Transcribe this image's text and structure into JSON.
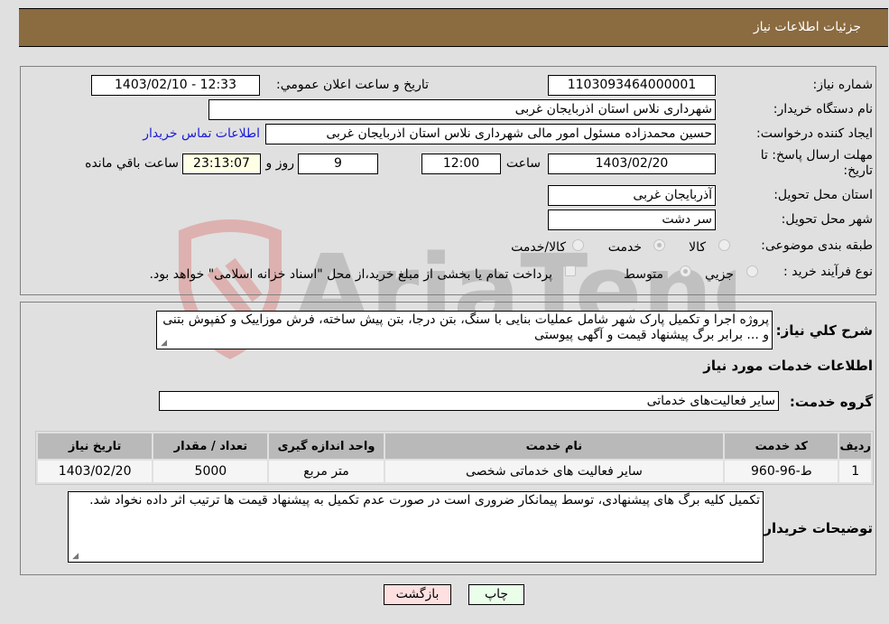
{
  "header": {
    "title": "جزئیات اطلاعات نیاز"
  },
  "form": {
    "need_number": {
      "label": "شماره نیاز:",
      "value": "1103093464000001"
    },
    "announce_datetime": {
      "label": "تاریخ و ساعت اعلان عمومي:",
      "value": "1403/02/10 - 12:33"
    },
    "buyer_org": {
      "label": "نام دستگاه خریدار:",
      "value": "شهرداری نلاس استان اذربایجان غربی"
    },
    "requester": {
      "label": "ایجاد کننده درخواست:",
      "value": "حسین محمدزاده مسئول امور مالی شهرداری نلاس استان اذربایجان غربی"
    },
    "buyer_contact_link": "اطلاعات تماس خریدار",
    "deadline": {
      "label": "مهلت ارسال پاسخ: تا تاریخ:",
      "date": "1403/02/20",
      "time_label": "ساعت",
      "time": "12:00",
      "days": "9",
      "days_label": "روز و",
      "remaining": "23:13:07",
      "remaining_label": "ساعت باقي مانده"
    },
    "delivery_province": {
      "label": "استان محل تحویل:",
      "value": "آذربایجان غربی"
    },
    "delivery_city": {
      "label": "شهر محل تحویل:",
      "value": "سر دشت"
    },
    "category": {
      "label": "طبقه بندی موضوعی:",
      "options": [
        "کالا",
        "خدمت",
        "کالا/خدمت"
      ],
      "selected": "خدمت"
    },
    "purchase_type": {
      "label": "نوع فرآیند خرید :",
      "options": [
        "جزيي",
        "متوسط"
      ],
      "selected": "متوسط",
      "note": "پرداخت تمام یا بخشی از مبلغ خرید،از محل \"اسناد خزانه اسلامی\" خواهد بود."
    }
  },
  "description": {
    "label": "شرح کلي نیاز:",
    "value": "پروژه اجرا و تکمیل پارک شهر شامل عملیات بنایی با سنگ، بتن درجا، بتن پیش ساخته، فرش موزاییک و کفپوش بتنی و ... برابر برگ پیشنهاد قیمت و آگهی پیوستی"
  },
  "services": {
    "section_title": "اطلاعات خدمات مورد نیاز",
    "group_label": "گروه خدمت:",
    "group_value": "سایر فعالیت‌های خدماتی",
    "table": {
      "headers": [
        "ردیف",
        "کد خدمت",
        "نام خدمت",
        "واحد اندازه گیری",
        "تعداد / مقدار",
        "تاریخ نیاز"
      ],
      "rows": [
        [
          "1",
          "ط-96-960",
          "سایر فعالیت های خدماتی شخصی",
          "متر مربع",
          "5000",
          "1403/02/20"
        ]
      ]
    }
  },
  "buyer_notes": {
    "label": "توضیحات خریدار:",
    "value": "تکمیل کلیه برگ های پیشنهادی، توسط پیمانکار ضروری است در صورت عدم تکمیل به پیشنهاد قیمت ها ترتیب اثر داده نخواد شد."
  },
  "buttons": {
    "print": "چاپ",
    "back": "بازگشت"
  },
  "colors": {
    "header_bg": "#8b6b40",
    "print_bg": "#eaffea",
    "back_bg": "#ffe0e0",
    "link": "#1a1adc"
  }
}
